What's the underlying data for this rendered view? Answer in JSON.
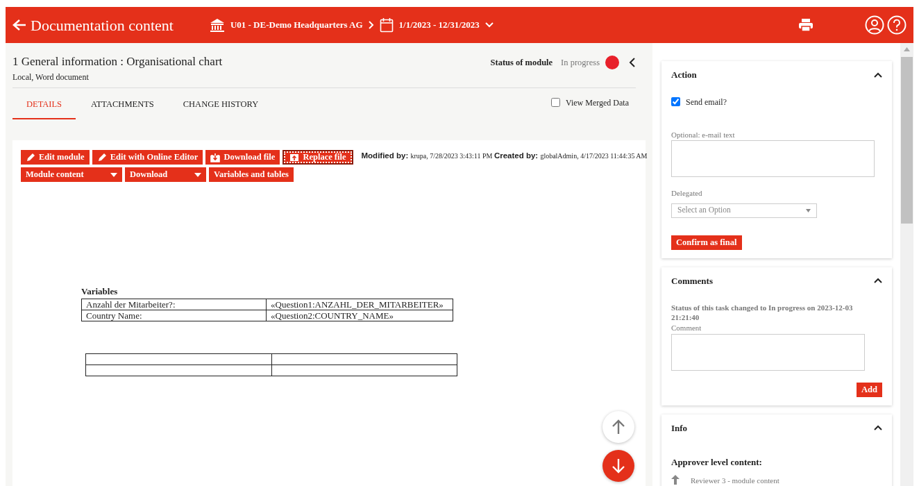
{
  "header": {
    "title": "Documentation content",
    "organisation": "U01 - DE-Demo Headquarters AG",
    "period": "1/1/2023 - 12/31/2023"
  },
  "module": {
    "title": "1 General information : Organisational chart",
    "subtitle": "Local, Word document",
    "status_label": "Status of module",
    "status": "In progress"
  },
  "tabs": [
    {
      "label": "DETAILS",
      "selected": true
    },
    {
      "label": "ATTACHMENTS",
      "selected": false
    },
    {
      "label": "CHANGE HISTORY",
      "selected": false
    }
  ],
  "view_merged": {
    "label": "View Merged Data",
    "checked": false
  },
  "toolbar": [
    [
      {
        "label": "Edit module",
        "kind": "edit",
        "focused": false
      },
      {
        "label": "Edit with Online Editor",
        "kind": "edit",
        "focused": false
      },
      {
        "label": "Download file",
        "kind": "download",
        "focused": false
      },
      {
        "label": "Replace file",
        "kind": "upload",
        "focused": true
      }
    ],
    [
      {
        "label": "Module content",
        "kind": "dropdown",
        "focused": false
      },
      {
        "label": "Download",
        "kind": "dropdown",
        "focused": false
      },
      {
        "label": "Variables and tables",
        "kind": "plain",
        "focused": false
      }
    ]
  ],
  "meta": {
    "modified_label": "Modified by:",
    "modified_value": "krupa, 7/28/2023 3:43:11 PM",
    "created_label": "Created by:",
    "created_value": "globalAdmin, 4/17/2023 11:44:35 AM"
  },
  "document": {
    "variables_title": "Variables",
    "variables": [
      {
        "label": "Anzahl der Mitarbeiter?:",
        "value": "«Question1:ANZAHL_DER_MITARBEITER»"
      },
      {
        "label": "Country Name:",
        "value": "«Question2:COUNTRY_NAME»"
      }
    ]
  },
  "action": {
    "title": "Action",
    "expanded": true,
    "send_email": {
      "label": "Send email?",
      "checked": true
    },
    "email_text_label": "Optional: e-mail text",
    "delegated_label": "Delegated",
    "delegated_placeholder": "Select an Option",
    "confirm": "Confirm as final"
  },
  "comments": {
    "title": "Comments",
    "expanded": true,
    "status_text": "Status of this task changed to In progress on 2023-12-03 21:21:40",
    "comment_label": "Comment",
    "add": "Add"
  },
  "info": {
    "title": "Info",
    "expanded": true,
    "approver_heading": "Approver level content:",
    "reviewer": "Reviewer 3 - module content"
  }
}
